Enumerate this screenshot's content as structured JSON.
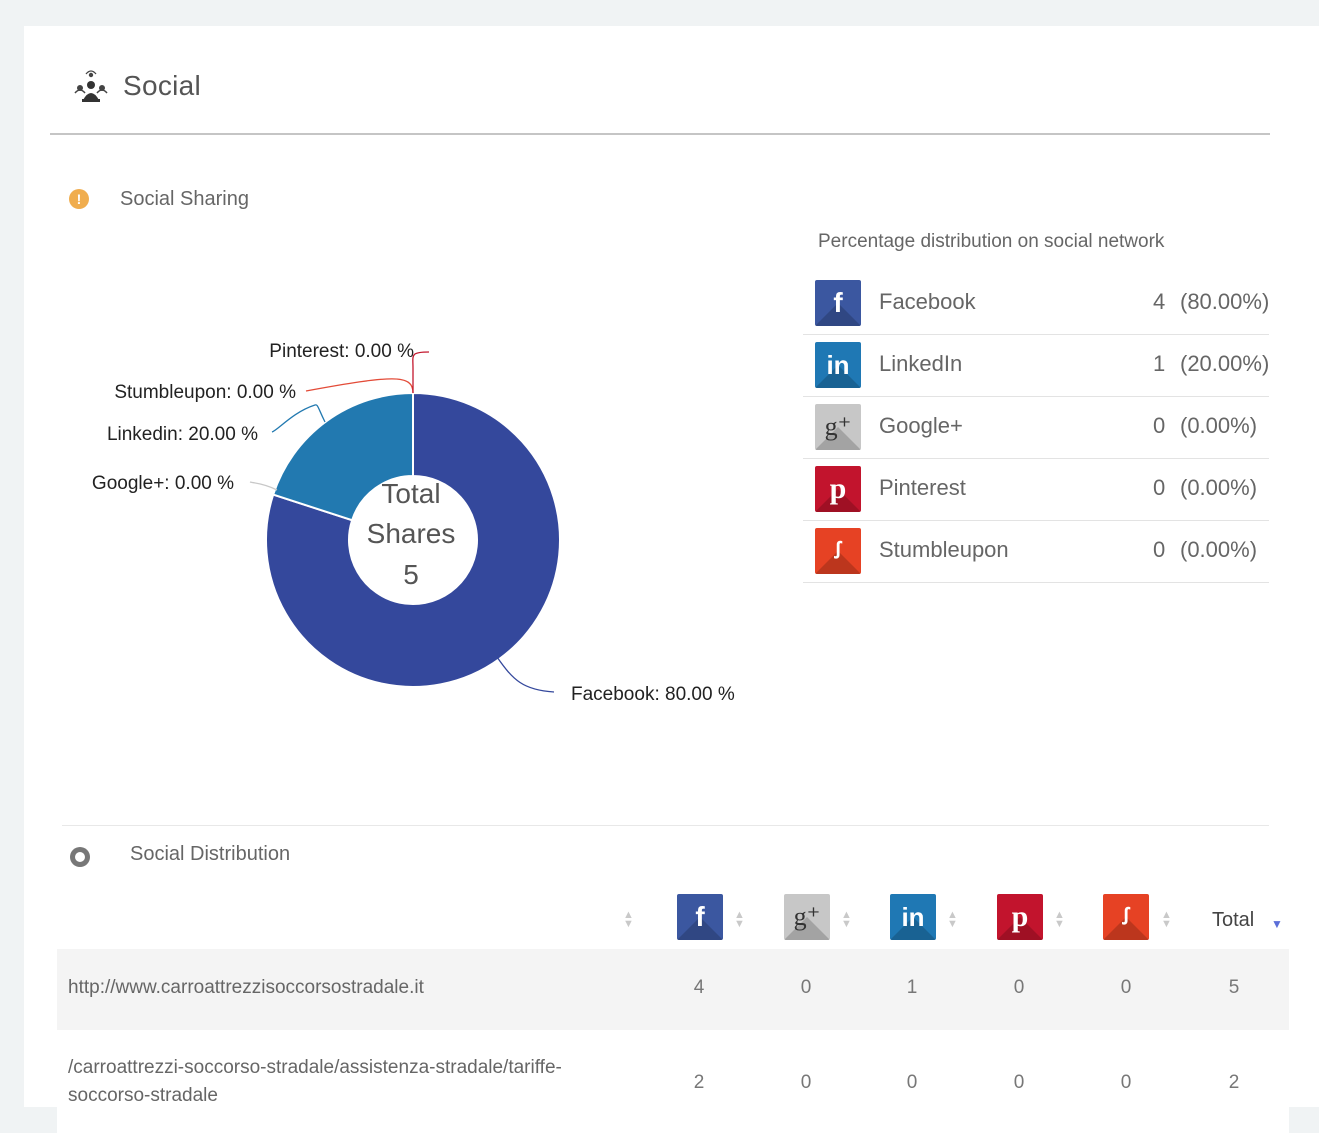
{
  "header": {
    "title": "Social",
    "icon": "social-people-icon"
  },
  "social_sharing": {
    "title": "Social Sharing",
    "icon": "alert-circle-icon",
    "donut_center": [
      "Total",
      "Shares",
      "5"
    ]
  },
  "chart_data": {
    "type": "pie",
    "title": "",
    "center_text": "Total Shares 5",
    "categories": [
      "Facebook",
      "Linkedin",
      "Google+",
      "Stumbleupon",
      "Pinterest"
    ],
    "values": [
      80.0,
      20.0,
      0.0,
      0.0,
      0.0
    ],
    "labels": [
      "Facebook: 80.00 %",
      "Linkedin: 20.00 %",
      "Google+: 0.00 %",
      "Stumbleupon: 0.00 %",
      "Pinterest: 0.00 %"
    ],
    "colors": [
      "#34489c",
      "#2279b0",
      "#c8c8c8",
      "#e34b38",
      "#c3182e"
    ],
    "donut": true
  },
  "legend": {
    "title": "Percentage distribution on social network",
    "rows": [
      {
        "name": "Facebook",
        "count": "4",
        "pct": "(80.00%)",
        "icon": "facebook-icon"
      },
      {
        "name": "LinkedIn",
        "count": "1",
        "pct": "(20.00%)",
        "icon": "linkedin-icon"
      },
      {
        "name": "Google+",
        "count": "0",
        "pct": "(0.00%)",
        "icon": "google-plus-icon"
      },
      {
        "name": "Pinterest",
        "count": "0",
        "pct": "(0.00%)",
        "icon": "pinterest-icon"
      },
      {
        "name": "Stumbleupon",
        "count": "0",
        "pct": "(0.00%)",
        "icon": "stumbleupon-icon"
      }
    ]
  },
  "distribution": {
    "title": "Social Distribution",
    "icon": "radio-circle-icon",
    "columns": [
      "Facebook",
      "Google+",
      "LinkedIn",
      "Pinterest",
      "Stumbleupon",
      "Total"
    ],
    "total_label": "Total",
    "rows": [
      {
        "url": "http://www.carroattrezzisoccorsostradale.it",
        "values": [
          "4",
          "0",
          "1",
          "0",
          "0",
          "5"
        ]
      },
      {
        "url": "/carroattrezzi-soccorso-stradale/assistenza-stradale/tariffe-soccorso-stradale",
        "values": [
          "2",
          "0",
          "0",
          "0",
          "0",
          "2"
        ]
      }
    ]
  },
  "colors": {
    "facebook": "#3b57a0",
    "linkedin": "#1f78b4",
    "google_plus": "#c7c7c7",
    "pinterest": "#c2142d",
    "stumbleupon": "#e64224",
    "warning": "#f0ad4e",
    "sort_active": "#5b6ed8"
  }
}
